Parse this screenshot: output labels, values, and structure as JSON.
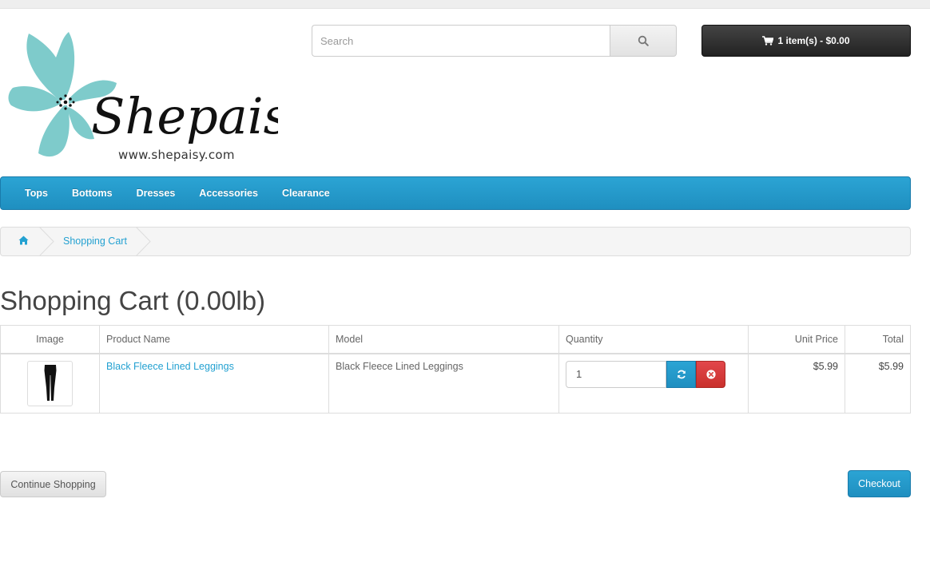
{
  "header": {
    "logo_text": "Shepaisy",
    "logo_url": "www.shepaisy.com",
    "search_placeholder": "Search",
    "cart_label": "1 item(s) - $0.00"
  },
  "menu": {
    "items": [
      "Tops",
      "Bottoms",
      "Dresses",
      "Accessories",
      "Clearance"
    ]
  },
  "breadcrumb": {
    "current": "Shopping Cart"
  },
  "page": {
    "title": "Shopping Cart  (0.00lb)"
  },
  "cart_table": {
    "headers": {
      "image": "Image",
      "name": "Product Name",
      "model": "Model",
      "quantity": "Quantity",
      "unit_price": "Unit Price",
      "total": "Total"
    },
    "rows": [
      {
        "name": "Black Fleece Lined Leggings",
        "model": "Black Fleece Lined Leggings",
        "quantity": "1",
        "unit_price": "$5.99",
        "total": "$5.99"
      }
    ]
  },
  "buttons": {
    "continue": "Continue Shopping",
    "checkout": "Checkout"
  },
  "colors": {
    "accent": "#229ac8",
    "danger": "#da4f49",
    "link": "#23a1d1",
    "logo_petal": "#7ecbcb"
  },
  "icons": {
    "search": "search-icon",
    "cart": "shopping-cart-icon",
    "home": "home-icon",
    "update": "refresh-icon",
    "remove": "times-circle-icon"
  }
}
